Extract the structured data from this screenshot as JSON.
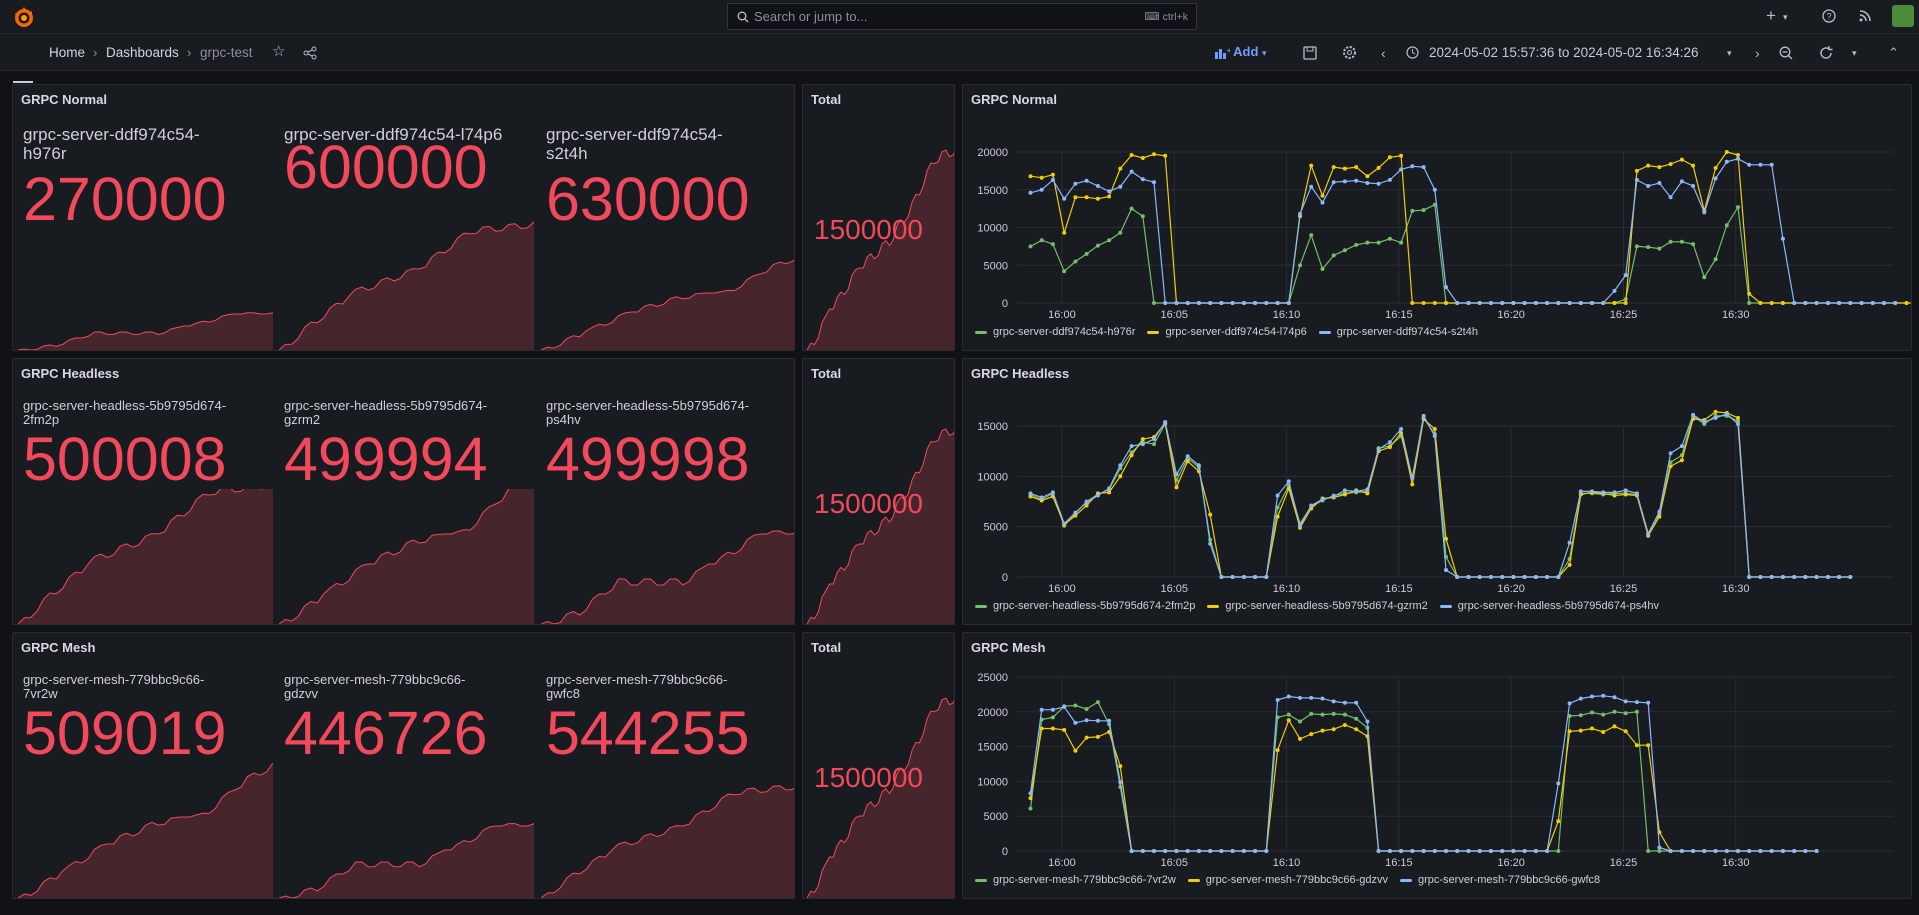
{
  "topbar": {
    "search_placeholder": "Search or jump to...",
    "search_shortcut": "ctrl+k"
  },
  "breadcrumb": {
    "home": "Home",
    "dashboards": "Dashboards",
    "current": "grpc-test"
  },
  "toolbar": {
    "add_label": "Add",
    "time_range": "2024-05-02 15:57:36 to 2024-05-02 16:34:26"
  },
  "colors": {
    "stat_red": "#f2495c",
    "green": "#73bf69",
    "yellow": "#f2cc0c",
    "blue": "#8ab8ff"
  },
  "rows": [
    {
      "title": "GRPC Normal",
      "total_title": "Total",
      "total": "1500000",
      "servers": [
        {
          "name": "grpc-server-ddf974c54-\nh976r",
          "value": "270000"
        },
        {
          "name": "grpc-server-ddf974c54-l74p6",
          "value": "600000"
        },
        {
          "name": "grpc-server-ddf974c54-\ns2t4h",
          "value": "630000"
        }
      ],
      "series_title": "GRPC Normal",
      "legend": [
        "grpc-server-ddf974c54-h976r",
        "grpc-server-ddf974c54-l74p6",
        "grpc-server-ddf974c54-s2t4h"
      ]
    },
    {
      "title": "GRPC Headless",
      "total_title": "Total",
      "total": "1500000",
      "servers": [
        {
          "name": "grpc-server-headless-5b9795d674-\n2fm2p",
          "value": "500008"
        },
        {
          "name": "grpc-server-headless-5b9795d674-\ngzrm2",
          "value": "499994"
        },
        {
          "name": "grpc-server-headless-5b9795d674-\nps4hv",
          "value": "499998"
        }
      ],
      "series_title": "GRPC Headless",
      "legend": [
        "grpc-server-headless-5b9795d674-2fm2p",
        "grpc-server-headless-5b9795d674-gzrm2",
        "grpc-server-headless-5b9795d674-ps4hv"
      ]
    },
    {
      "title": "GRPC Mesh",
      "total_title": "Total",
      "total": "1500000",
      "servers": [
        {
          "name": "grpc-server-mesh-779bbc9c66-\n7vr2w",
          "value": "509019"
        },
        {
          "name": "grpc-server-mesh-779bbc9c66-\ngdzvv",
          "value": "446726"
        },
        {
          "name": "grpc-server-mesh-779bbc9c66-\ngwfc8",
          "value": "544255"
        }
      ],
      "series_title": "GRPC Mesh",
      "legend": [
        "grpc-server-mesh-779bbc9c66-7vr2w",
        "grpc-server-mesh-779bbc9c66-gdzvv",
        "grpc-server-mesh-779bbc9c66-gwfc8"
      ]
    }
  ],
  "chart_data": [
    {
      "type": "line",
      "title": "GRPC Normal",
      "x": [
        "15:58:36",
        "...",
        "16:33:36"
      ],
      "x_ticks": [
        "16:00",
        "16:05",
        "16:10",
        "16:15",
        "16:20",
        "16:25",
        "16:30"
      ],
      "ylim": [
        0,
        20000
      ],
      "y_ticks": [
        0,
        5000,
        10000,
        15000,
        20000
      ],
      "x_start_min": 58.6,
      "x_step_min": 0.5,
      "series": [
        {
          "name": "grpc-server-ddf974c54-h976r",
          "color": "#73bf69",
          "values": [
            7500,
            8300,
            7800,
            4200,
            5500,
            6500,
            7600,
            8300,
            9300,
            12500,
            11500,
            0,
            0,
            0,
            0,
            0,
            0,
            0,
            0,
            0,
            0,
            0,
            0,
            0,
            5000,
            9000,
            4500,
            6300,
            7000,
            7700,
            8000,
            8000,
            8500,
            8000,
            12200,
            12300,
            13000,
            0,
            0,
            0,
            0,
            0,
            0,
            0,
            0,
            0,
            0,
            0,
            0,
            0,
            0,
            0,
            0,
            500,
            7500,
            7400,
            7200,
            8100,
            8100,
            7800,
            3400,
            5800,
            10300,
            12700,
            0,
            0,
            0,
            0,
            0,
            0,
            0,
            0,
            0,
            0,
            0,
            0,
            0,
            0,
            0
          ]
        },
        {
          "name": "grpc-server-ddf974c54-l74p6",
          "color": "#f2cc0c",
          "values": [
            16800,
            16600,
            17000,
            9300,
            14000,
            14000,
            13800,
            14100,
            17800,
            19600,
            19200,
            19700,
            19500,
            0,
            0,
            0,
            0,
            0,
            0,
            0,
            0,
            0,
            0,
            0,
            11500,
            18200,
            14200,
            18000,
            17800,
            18000,
            16800,
            17900,
            19300,
            19500,
            0,
            0,
            0,
            0,
            0,
            0,
            0,
            0,
            0,
            0,
            0,
            0,
            0,
            0,
            0,
            0,
            0,
            0,
            0,
            0,
            17500,
            18200,
            18000,
            18400,
            19000,
            18200,
            12200,
            17900,
            20000,
            19600,
            1200,
            0,
            0,
            0,
            0,
            0,
            0,
            0,
            0,
            0,
            0,
            0,
            0,
            0,
            0,
            0,
            0
          ]
        },
        {
          "name": "grpc-server-ddf974c54-s2t4h",
          "color": "#8ab8ff",
          "values": [
            14600,
            15000,
            16300,
            13800,
            15800,
            16200,
            15500,
            14800,
            15400,
            17400,
            16400,
            16000,
            0,
            0,
            0,
            0,
            0,
            0,
            0,
            0,
            0,
            0,
            0,
            0,
            11800,
            15400,
            13300,
            16000,
            16100,
            16200,
            15900,
            15800,
            16300,
            17700,
            18100,
            18000,
            15000,
            2100,
            0,
            0,
            0,
            0,
            0,
            0,
            0,
            0,
            0,
            0,
            0,
            0,
            0,
            0,
            1600,
            3700,
            16300,
            15500,
            15900,
            14000,
            16100,
            15500,
            12000,
            16500,
            18700,
            19100,
            18300,
            18300,
            18300,
            8500,
            0,
            0,
            0,
            0,
            0,
            0,
            0,
            0,
            0,
            0
          ]
        }
      ]
    },
    {
      "type": "line",
      "title": "GRPC Headless",
      "x_ticks": [
        "16:00",
        "16:05",
        "16:10",
        "16:15",
        "16:20",
        "16:25",
        "16:30"
      ],
      "ylim": [
        0,
        15000
      ],
      "y_ticks": [
        0,
        5000,
        10000,
        15000
      ],
      "x_start_min": 58.6,
      "x_step_min": 0.5,
      "series": [
        {
          "name": "grpc-server-headless-5b9795d674-2fm2p",
          "color": "#73bf69",
          "values": [
            8200,
            7700,
            8300,
            5100,
            6300,
            7500,
            8200,
            8700,
            10800,
            12400,
            13400,
            13200,
            15200,
            9600,
            11800,
            10900,
            3700,
            0,
            0,
            0,
            0,
            0,
            6900,
            9100,
            5300,
            7000,
            7600,
            8100,
            8300,
            8400,
            8500,
            12800,
            13000,
            14000,
            9900,
            15800,
            14200,
            2000,
            0,
            0,
            0,
            0,
            0,
            0,
            0,
            0,
            0,
            0,
            1800,
            8300,
            8300,
            8200,
            8300,
            8300,
            8200,
            4300,
            6300,
            11400,
            12100,
            16000,
            15200,
            16000,
            16000,
            15500,
            0,
            0,
            0,
            0,
            0,
            0,
            0,
            0,
            0,
            0
          ]
        },
        {
          "name": "grpc-server-headless-5b9795d674-gzrm2",
          "color": "#f2cc0c",
          "values": [
            8000,
            7600,
            8000,
            5200,
            6100,
            7100,
            8300,
            8400,
            10000,
            12100,
            13700,
            13900,
            15300,
            8900,
            11500,
            10500,
            6200,
            0,
            0,
            0,
            0,
            0,
            6000,
            8800,
            4900,
            6800,
            7800,
            7900,
            8200,
            8600,
            8300,
            12500,
            12900,
            14300,
            9200,
            15700,
            14700,
            3800,
            0,
            0,
            0,
            0,
            0,
            0,
            0,
            0,
            0,
            0,
            1200,
            8200,
            8400,
            8300,
            8100,
            8200,
            8100,
            4100,
            6000,
            11000,
            11600,
            15700,
            15600,
            16400,
            16300,
            15800,
            0,
            0,
            0,
            0,
            0,
            0,
            0,
            0,
            0,
            0
          ]
        },
        {
          "name": "grpc-server-headless-5b9795d674-ps4hv",
          "color": "#8ab8ff",
          "values": [
            8300,
            7900,
            8400,
            5300,
            6400,
            7400,
            8100,
            8800,
            11100,
            13000,
            13200,
            13700,
            15400,
            10200,
            12000,
            11100,
            3300,
            0,
            0,
            0,
            0,
            0,
            8100,
            9500,
            5100,
            7100,
            7700,
            8000,
            8600,
            8500,
            8700,
            12700,
            13400,
            14700,
            9800,
            16000,
            14000,
            700,
            0,
            0,
            0,
            0,
            0,
            0,
            0,
            0,
            0,
            0,
            3400,
            8500,
            8500,
            8400,
            8400,
            8600,
            8300,
            4300,
            6500,
            12300,
            13000,
            16100,
            15400,
            15800,
            16200,
            15200,
            0,
            0,
            0,
            0,
            0,
            0,
            0,
            0,
            0,
            0
          ]
        }
      ]
    },
    {
      "type": "line",
      "title": "GRPC Mesh",
      "x_ticks": [
        "16:00",
        "16:05",
        "16:10",
        "16:15",
        "16:20",
        "16:25",
        "16:30"
      ],
      "ylim": [
        0,
        25000
      ],
      "y_ticks": [
        0,
        5000,
        10000,
        15000,
        20000,
        25000
      ],
      "x_start_min": 58.6,
      "x_step_min": 0.5,
      "series": [
        {
          "name": "grpc-server-mesh-779bbc9c66-7vr2w",
          "color": "#73bf69",
          "values": [
            6100,
            18900,
            19200,
            20800,
            20900,
            20400,
            21400,
            18200,
            9200,
            0,
            0,
            0,
            0,
            0,
            0,
            0,
            0,
            0,
            0,
            0,
            0,
            0,
            19200,
            19600,
            18600,
            19700,
            19600,
            19700,
            19600,
            19000,
            17700,
            0,
            0,
            0,
            0,
            0,
            0,
            0,
            0,
            0,
            0,
            0,
            0,
            0,
            0,
            0,
            0,
            0,
            19400,
            19500,
            19900,
            19600,
            20000,
            19800,
            20000,
            0,
            0,
            0,
            0,
            0,
            0,
            0,
            0,
            0,
            0,
            0,
            0,
            0,
            0,
            0,
            0
          ]
        },
        {
          "name": "grpc-server-mesh-779bbc9c66-gdzvv",
          "color": "#f2cc0c",
          "values": [
            7600,
            17600,
            17600,
            17400,
            14400,
            16300,
            16400,
            17100,
            12200,
            0,
            0,
            0,
            0,
            0,
            0,
            0,
            0,
            0,
            0,
            0,
            0,
            0,
            14500,
            18800,
            16100,
            16800,
            17300,
            17500,
            18100,
            17500,
            16500,
            0,
            0,
            0,
            0,
            0,
            0,
            0,
            0,
            0,
            0,
            0,
            0,
            0,
            0,
            0,
            0,
            4300,
            17200,
            17300,
            17600,
            17100,
            17900,
            17200,
            15200,
            15200,
            2700,
            0,
            0,
            0,
            0,
            0,
            0,
            0,
            0,
            0,
            0,
            0,
            0,
            0,
            0
          ]
        },
        {
          "name": "grpc-server-mesh-779bbc9c66-gwfc8",
          "color": "#8ab8ff",
          "values": [
            8300,
            20300,
            20300,
            20700,
            18400,
            18800,
            18700,
            18700,
            9900,
            0,
            0,
            0,
            0,
            0,
            0,
            0,
            0,
            0,
            0,
            0,
            0,
            0,
            21700,
            22200,
            22000,
            22000,
            21900,
            21500,
            21300,
            21300,
            18600,
            0,
            0,
            0,
            0,
            0,
            0,
            0,
            0,
            0,
            0,
            0,
            0,
            0,
            0,
            0,
            0,
            9700,
            21200,
            21900,
            22200,
            22300,
            22100,
            21500,
            21400,
            21300,
            500,
            0,
            0,
            0,
            0,
            0,
            0,
            0,
            0,
            0,
            0,
            0,
            0,
            0,
            0
          ]
        }
      ]
    }
  ]
}
